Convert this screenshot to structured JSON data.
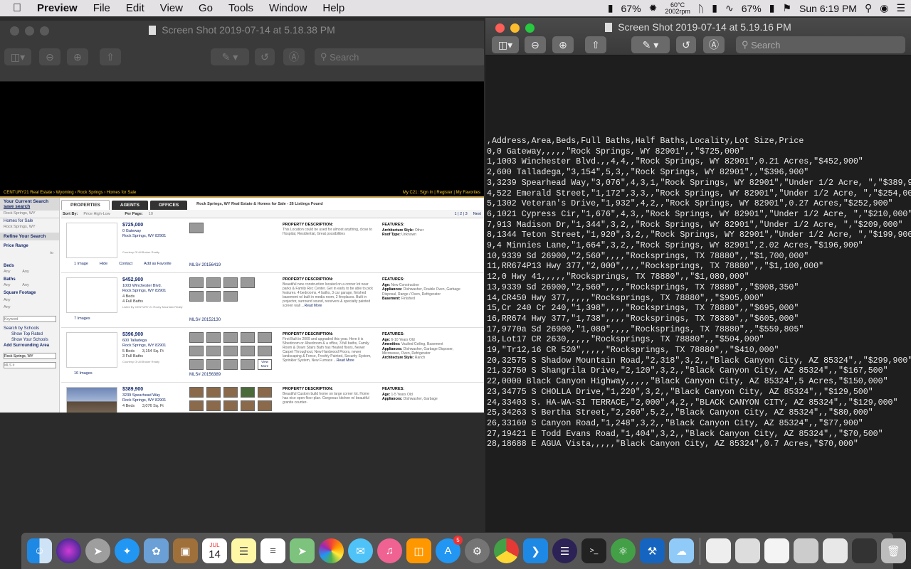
{
  "menubar": {
    "app": "Preview",
    "items": [
      "File",
      "Edit",
      "View",
      "Go",
      "Tools",
      "Window",
      "Help"
    ],
    "battery_pct_1": "67%",
    "temp": "60°C",
    "rpm": "2002rpm",
    "battery_pct_2": "67%",
    "clock": "Sun 6:19 PM"
  },
  "window_left": {
    "title": "Screen Shot 2019-07-14 at 5.18.38 PM",
    "search_placeholder": "Search"
  },
  "window_right": {
    "title": "Screen Shot 2019-07-14 at 5.19.16 PM",
    "search_placeholder": "Search"
  },
  "csv_lines": [
    ",Address,Area,Beds,Full Baths,Half Baths,Locality,Lot Size,Price",
    "0,0 Gateway,,,,,\"Rock Springs, WY 82901\",,\"$725,000\"",
    "1,1003 Winchester Blvd.,,4,4,,\"Rock Springs, WY 82901\",0.21 Acres,\"$452,900\"",
    "2,600 Talladega,\"3,154\",5,3,,\"Rock Springs, WY 82901\",,\"$396,900\"",
    "3,3239 Spearhead Way,\"3,076\",4,3,1,\"Rock Springs, WY 82901\",\"Under 1/2 Acre, \",\"$389,900\"",
    "4,522 Emerald Street,\"1,172\",3,3,,\"Rock Springs, WY 82901\",\"Under 1/2 Acre, \",\"$254,000\"",
    "5,1302 Veteran's Drive,\"1,932\",4,2,,\"Rock Springs, WY 82901\",0.27 Acres,\"$252,900\"",
    "6,1021 Cypress Cir,\"1,676\",4,3,,\"Rock Springs, WY 82901\",\"Under 1/2 Acre, \",\"$210,000\"",
    "7,913 Madison Dr,\"1,344\",3,2,,\"Rock Springs, WY 82901\",\"Under 1/2 Acre, \",\"$209,000\"",
    "8,1344 Teton Street,\"1,920\",3,2,,\"Rock Springs, WY 82901\",\"Under 1/2 Acre, \",\"$199,900\"",
    "9,4 Minnies Lane,\"1,664\",3,2,,\"Rock Springs, WY 82901\",2.02 Acres,\"$196,900\"",
    "10,9339 Sd 26900,\"2,560\",,,,\"Rocksprings, TX 78880\",,\"$1,700,000\"",
    "11,RR674P13 Hwy 377,\"2,000\",,,,\"Rocksprings, TX 78880\",,\"$1,100,000\"",
    "12,0 Hwy 41,,,,,\"Rocksprings, TX 78880\",,\"$1,080,000\"",
    "13,9339 Sd 26900,\"2,560\",,,,\"Rocksprings, TX 78880\",,\"$908,350\"",
    "14,CR450 Hwy 377,,,,,\"Rocksprings, TX 78880\",,\"$905,000\"",
    "15,Cr 240 Cr 240,\"1,398\",,,,\"Rocksprings, TX 78880\",,\"$695,000\"",
    "16,RR674 Hwy 377,\"1,738\",,,,\"Rocksprings, TX 78880\",,\"$605,000\"",
    "17,9770a Sd 26900,\"1,080\",,,,\"Rocksprings, TX 78880\",,\"$559,805\"",
    "18,Lot17 CR 2630,,,,,\"Rocksprings, TX 78880\",,\"$504,000\"",
    "19,\"Tr12,16 CR 520\",,,,,\"Rocksprings, TX 78880\",,\"$410,000\"",
    "20,32575 S Shadow Mountain Road,\"2,318\",3,2,,\"Black Canyon City, AZ 85324\",,\"$299,900\"",
    "21,32750 S Shangrila Drive,\"2,120\",3,2,,\"Black Canyon City, AZ 85324\",,\"$167,500\"",
    "22,0000 Black Canyon Highway,,,,,\"Black Canyon City, AZ 85324\",5 Acres,\"$150,000\"",
    "23,34775 S CHOLLA Drive,\"1,220\",3,2,,\"Black Canyon City, AZ 85324\",,\"$129,500\"",
    "24,33403 S. HA-WA-SI TERRACE,\"2,000\",4,2,,\"BLACK CANYON CITY, AZ 85324\",,\"$129,000\"",
    "25,34263 S Bertha Street,\"2,260\",5,2,,\"Black Canyon City, AZ 85324\",,\"$80,000\"",
    "26,33160 S Canyon Road,\"1,248\",3,2,,\"Black Canyon City, AZ 85324\",,\"$77,900\"",
    "27,19421 E Todd Evans Road,\"1,404\",3,2,,\"Black Canyon City, AZ 85324\",,\"$70,500\"",
    "28,18688 E AGUA Vista,,,,,\"Black Canyon City, AZ 85324\",0.7 Acres,\"$70,000\""
  ],
  "web": {
    "topbar_left": "CENTURY21 Real Estate › Wyoming › Rock Springs › Homes for Sale",
    "topbar_right": "My C21: Sign In | Register | My Favorites",
    "sidebar": {
      "current_search": "Your Current Search",
      "save_search": "save search",
      "location": "Rock Springs, WY",
      "homes_for_sale": "Homes for Sale",
      "location2": "Rock Springs, WY",
      "refine": "Refine Your Search",
      "price_range": "Price Range",
      "to": "to",
      "beds": "Beds",
      "any": "Any",
      "baths": "Baths",
      "square_footage": "Square Footage",
      "keyword_placeholder": "Keyword",
      "search_by_schools": "Search by Schools",
      "show_top_rated": "Show Top Rated",
      "show_your_schools": "Show Your Schools",
      "add_surrounding": "Add Surrounding Area",
      "area_input": "Rock Springs, WY",
      "mls_placeholder": "MLS #"
    },
    "tabs": [
      "PROPERTIES",
      "AGENTS",
      "OFFICES"
    ],
    "crumb": "Rock Springs, WY Real Estate & Homes for Sale - 26 Listings Found",
    "sort_by_label": "Sort By:",
    "sort_by_value": "Price High-Low",
    "per_page_label": "Per Page:",
    "per_page_value": "10",
    "pages": "1 | 2 | 3",
    "next": "Next",
    "listings": [
      {
        "price": "$725,000",
        "addr1": "0 Gateway",
        "addr2": "Rock Springs, WY 82901",
        "beds": "",
        "baths": "",
        "courtesy": "Courtesy Of All Broker Realty",
        "links": [
          "1 Image",
          "Hide",
          "Contact",
          "Add as Favorite"
        ],
        "mls": "MLS# 20156419",
        "desc_title": "PROPERTY DESCRIPTION:",
        "desc": "This Location could be used for almost anything, close to Hospital, Residential, Great possibilities",
        "features": [
          [
            "Architecture Style:",
            "Other"
          ],
          [
            "Roof Type:",
            "Unknown"
          ]
        ]
      },
      {
        "price": "$452,900",
        "addr1": "1003 Winchester Blvd.",
        "addr2": "Rock Springs, WY 82901",
        "beds": "4 Beds",
        "baths": "4 Full Baths",
        "courtesy": "Listed By CENTURY 21 Rocky Mountain Realty",
        "links": [
          "7 Images"
        ],
        "mls": "MLS# 20152130",
        "desc_title": "PROPERTY DESCRIPTION:",
        "desc": "Beautiful new construction located on a corner lot near parks & Family Rec Center. Get in early to be able to pick features. 4 bedrooms, 4 baths, 3 car garage, finished basement w/ built in media room, 2 fireplaces. Built in projector, surround sound, receivers & specialty painted screen wall ...",
        "features": [
          [
            "Age:",
            "New Construction"
          ],
          [
            "Appliances:",
            "Dishwasher, Double Oven, Garbage Disposal, Range / Oven, Refrigerator"
          ],
          [
            "Basement:",
            "Finished"
          ]
        ]
      },
      {
        "price": "$396,900",
        "addr1": "600 Talladega",
        "addr2": "Rock Springs, WY 82901",
        "beds": "5 Beds",
        "baths": "3 Full Baths",
        "sqft": "3,154 Sq. Ft",
        "courtesy": "Courtesy Of All Broker Realty",
        "links": [
          "16 Images"
        ],
        "mls": "MLS# 20156389",
        "desc_title": "PROPERTY DESCRIPTION:",
        "desc": "First Built in 2009 and upgraded this year. Here it is 5/bedroom or 4/bedroom & a office, 3 full baths, Family Room & Down Stairs Bath has Heated floors, Newer Carpet Throughout, New Hardwood Floors, newer landscaping & Fence, Freshly Painted, Security System, Sprinkler System, New Furnace ...",
        "features": [
          [
            "Age:",
            "6-10 Years Old"
          ],
          [
            "Amenities:",
            "Vaulted Ceiling, Basement"
          ],
          [
            "Appliances:",
            "Dishwasher, Garbage Disposer, Microwave, Oven, Refrigerator"
          ],
          [
            "Architecture Style:",
            "Ranch"
          ]
        ]
      },
      {
        "price": "$389,900",
        "addr1": "3239 Spearhead Way",
        "addr2": "Rock Springs, WY 82901",
        "beds": "4 Beds",
        "baths": "",
        "sqft": "3,076 Sq. Ft",
        "courtesy": "",
        "links": [],
        "mls": "",
        "desc_title": "PROPERTY DESCRIPTION:",
        "desc": "Beautiful Custom build home on large corner lot. Home has nice open floor plan. Gorgeous kitchen w/ beautiful granite counter-",
        "features": [
          [
            "Age:",
            "1-5 Years Old"
          ],
          [
            "Appliances:",
            "Dishwasher, Garbage"
          ]
        ]
      }
    ],
    "read_more": "Read More",
    "view_more": "View More",
    "features_title": "FEATURES:"
  },
  "dock_apps": [
    "Finder",
    "Siri",
    "Launchpad",
    "Safari",
    "Preview",
    "Notebook",
    "Calendar",
    "Notes",
    "Reminders",
    "Maps",
    "Photos",
    "Messages",
    "Music",
    "Books",
    "App Store",
    "System Preferences",
    "Chrome",
    "VS Code",
    "Eclipse",
    "Terminal",
    "Atom",
    "Xcode",
    "Preview2"
  ],
  "dock_calendar_month": "JUL",
  "dock_calendar_day": "14",
  "dock_appstore_badge": "5"
}
